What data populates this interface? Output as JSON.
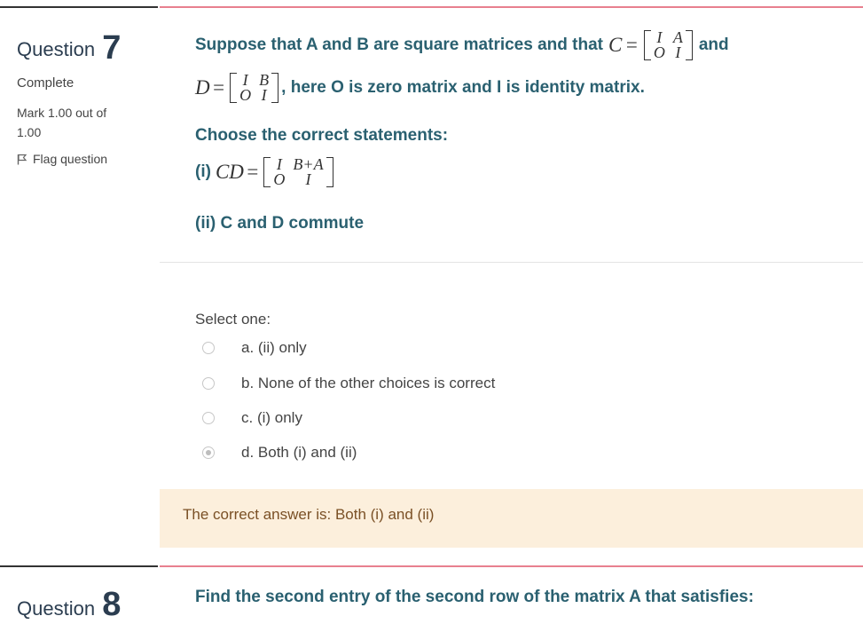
{
  "question7": {
    "label": "Question",
    "number": "7",
    "state": "Complete",
    "grade": "Mark 1.00 out of 1.00",
    "flag_label": "Flag question",
    "line1_text": "Suppose that A and B are square matrices and that",
    "line1_C": "C",
    "matrix_C": [
      "I",
      "A",
      "O",
      "I"
    ],
    "line1_and": "and",
    "line2_D": "D",
    "matrix_D": [
      "I",
      "B",
      "O",
      "I"
    ],
    "line2_text": ", here O is zero matrix and I is identity matrix.",
    "choose": "Choose the correct statements:",
    "stmt1_prefix": "(i)",
    "stmt1_lhs": "CD",
    "matrix_CD": [
      "I",
      "B+A",
      "O",
      "I"
    ],
    "stmt2": "(ii) C and D commute",
    "select_one": "Select one:",
    "options": [
      {
        "label": "a. (ii) only",
        "selected": false
      },
      {
        "label": "b. None of the other choices is correct",
        "selected": false
      },
      {
        "label": "c. (i) only",
        "selected": false
      },
      {
        "label": "d. Both (i) and (ii)",
        "selected": true
      }
    ],
    "feedback": "The correct answer is: Both (i) and (ii)"
  },
  "question8": {
    "label": "Question",
    "number": "8",
    "text": "Find the second entry of the second row of the matrix A that satisfies:"
  }
}
